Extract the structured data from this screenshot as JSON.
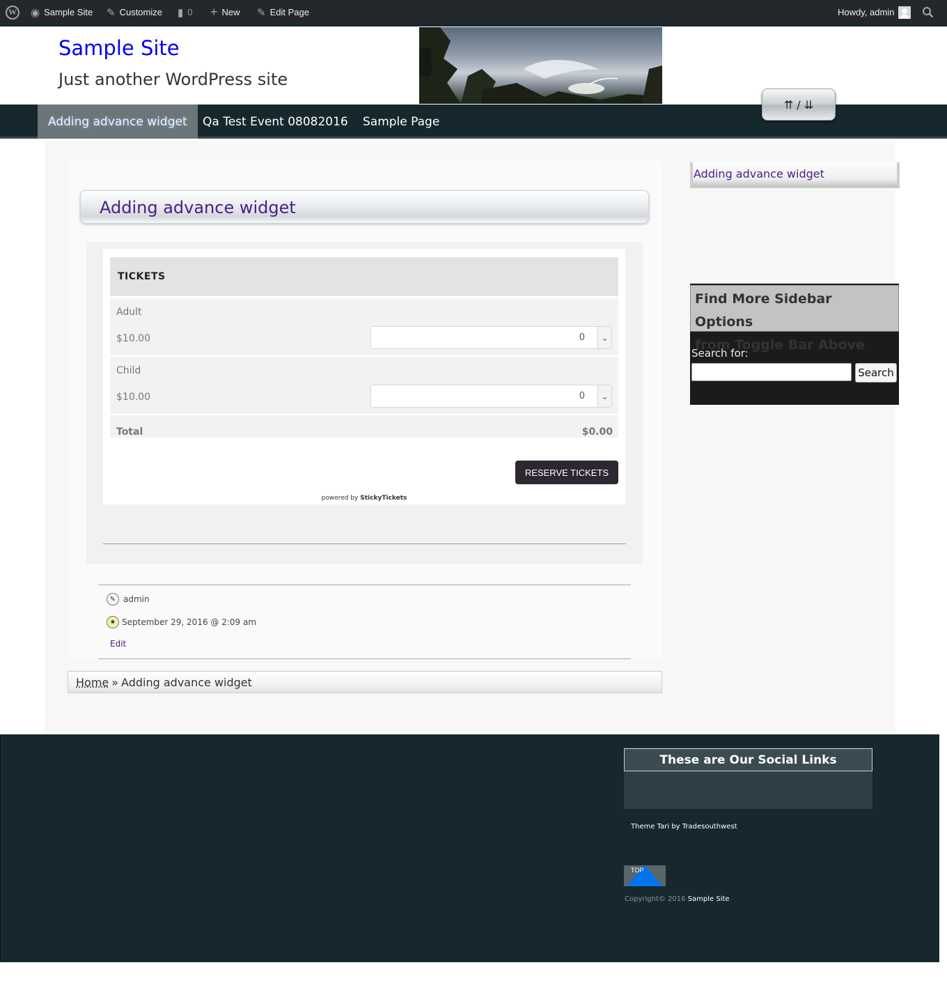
{
  "admin_bar": {
    "wp_logo": "W",
    "site_name": "Sample Site",
    "customize": "Customize",
    "comments_count": "0",
    "new": "New",
    "edit_page": "Edit Page",
    "howdy": "Howdy, admin"
  },
  "header": {
    "site_title": "Sample Site",
    "tagline": "Just another WordPress site",
    "toggle_label": "⇈ / ⇊"
  },
  "nav": {
    "items": [
      {
        "label": "Adding advance widget"
      },
      {
        "label": "Qa Test Event 08082016"
      },
      {
        "label": "Sample Page"
      }
    ]
  },
  "article": {
    "title": "Adding advance widget",
    "tickets_heading": "TICKETS",
    "tickets": [
      {
        "name": "Adult",
        "price": "$10.00",
        "quantity": "0"
      },
      {
        "name": "Child",
        "price": "$10.00",
        "quantity": "0"
      }
    ],
    "total_label": "Total",
    "total_value": "$0.00",
    "reserve_label": "RESERVE TICKETS",
    "powered_by": "powered by",
    "powered_brand": "StickyTickets",
    "author": "admin",
    "date": "September 29, 2016 @ 2:09 am",
    "edit": "Edit"
  },
  "breadcrumb": {
    "home": "Home",
    "separator": "»",
    "current": "Adding advance widget"
  },
  "sidebar": {
    "widget1_link": "Adding advance widget",
    "widget2_title_line1": "Find More Sidebar Options",
    "widget2_title_line2": "from Toggle Bar Above",
    "search_label": "Search for:",
    "search_button": "Search"
  },
  "footer": {
    "social_title": "These are Our Social Links",
    "theme_credit": "Theme Tari by Tradesouthwest",
    "top_label": "TOP",
    "copyright_prefix": "Copyright© 2016",
    "copyright_site": "Sample Site"
  },
  "colors": {
    "admin_bar": "#23282d",
    "nav_bg": "#16282e",
    "link_purple": "#4b2086",
    "site_title_blue": "#0000ee",
    "top_button_blue": "#0074e8"
  }
}
